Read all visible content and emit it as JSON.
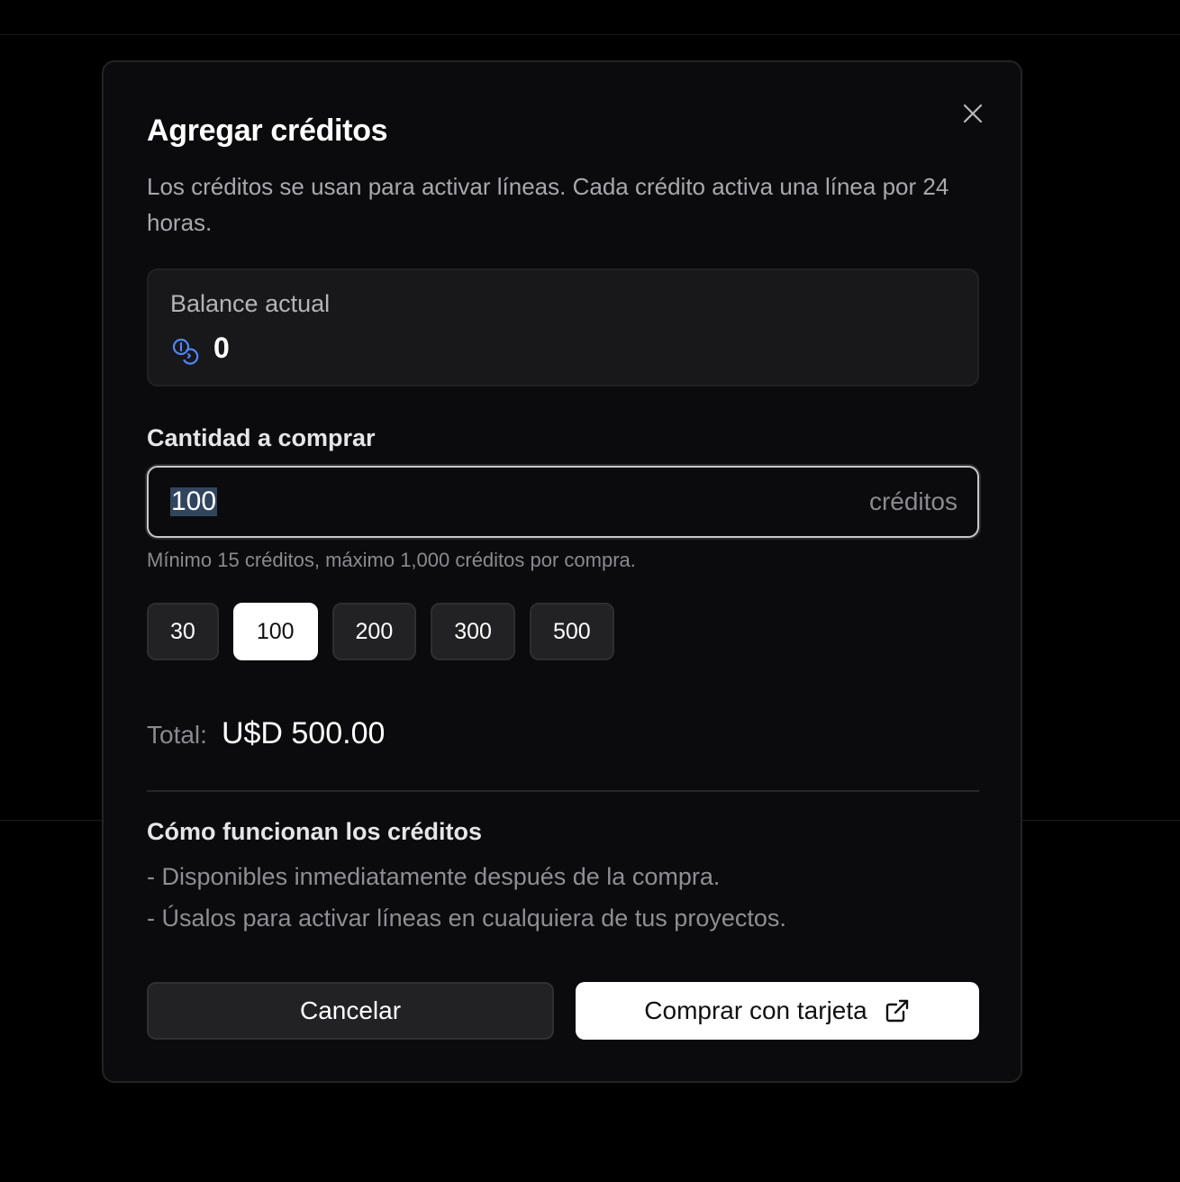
{
  "modal": {
    "title": "Agregar créditos",
    "subtitle": "Los créditos se usan para activar líneas. Cada crédito activa una línea por 24 horas.",
    "close_icon": "close-icon"
  },
  "balance": {
    "label": "Balance actual",
    "icon": "coins-icon",
    "value": "0",
    "icon_color": "#4f86f7"
  },
  "quantity": {
    "label": "Cantidad a comprar",
    "value": "100",
    "suffix": "créditos",
    "hint": "Mínimo 15 créditos, máximo 1,000 créditos por compra."
  },
  "presets": [
    {
      "label": "30",
      "selected": false
    },
    {
      "label": "100",
      "selected": true
    },
    {
      "label": "200",
      "selected": false
    },
    {
      "label": "300",
      "selected": false
    },
    {
      "label": "500",
      "selected": false
    }
  ],
  "total": {
    "label": "Total:",
    "value": "U$D 500.00"
  },
  "how_it_works": {
    "title": "Cómo funcionan los créditos",
    "items": [
      "- Disponibles inmediatamente después de la compra.",
      "- Úsalos para activar líneas en cualquiera de tus proyectos."
    ]
  },
  "actions": {
    "cancel_label": "Cancelar",
    "buy_label": "Comprar con tarjeta",
    "buy_icon": "external-link-icon"
  }
}
